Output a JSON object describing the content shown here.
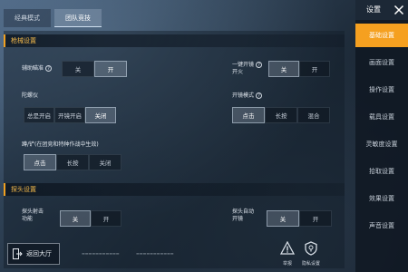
{
  "tabs": [
    {
      "label": "经典模式",
      "active": false
    },
    {
      "label": "团队竞技",
      "active": true
    }
  ],
  "sections": {
    "firearm": "枪械设置",
    "peek": "探头设置"
  },
  "rows": {
    "aim_assist": {
      "label": "辅助瞄准",
      "options": [
        "关",
        "开"
      ],
      "selected": 1
    },
    "one_tap_fire": {
      "label_line1": "一键开镜",
      "label_line2": "开火",
      "options": [
        "关",
        "开"
      ],
      "selected": 0
    },
    "gyro": {
      "label": "陀螺仪",
      "options": [
        "总是开启",
        "开镜开启",
        "关闭"
      ],
      "selected": 2
    },
    "scope_mode": {
      "label": "开镜模式",
      "options": [
        "点击",
        "长按",
        "混合"
      ],
      "selected": 0
    },
    "lean": {
      "label": "蹲/铲(在团竞和特种作战中生效)",
      "options": [
        "点击",
        "长按",
        "关闭"
      ],
      "selected": 0
    },
    "peek_fire": {
      "label_line1": "探头射击",
      "label_line2": "功能",
      "options": [
        "关",
        "开"
      ],
      "selected": 0
    },
    "peek_auto_scope": {
      "label_line1": "探头自动",
      "label_line2": "开镜",
      "options": [
        "关",
        "开"
      ],
      "selected": 0
    }
  },
  "bottom": {
    "back_label": "返回大厅",
    "report_label": "举报",
    "privacy_label": "隐私设置"
  },
  "sidebar": {
    "title": "设置",
    "items": [
      {
        "label": "基础设置",
        "active": true
      },
      {
        "label": "画面设置",
        "active": false
      },
      {
        "label": "操作设置",
        "active": false
      },
      {
        "label": "载具设置",
        "active": false
      },
      {
        "label": "灵敏度设置",
        "active": false
      },
      {
        "label": "拾取设置",
        "active": false
      },
      {
        "label": "效果设置",
        "active": false
      },
      {
        "label": "声音设置",
        "active": false
      }
    ]
  },
  "colors": {
    "accent": "#f5a020",
    "section_title": "#f2b84a"
  }
}
